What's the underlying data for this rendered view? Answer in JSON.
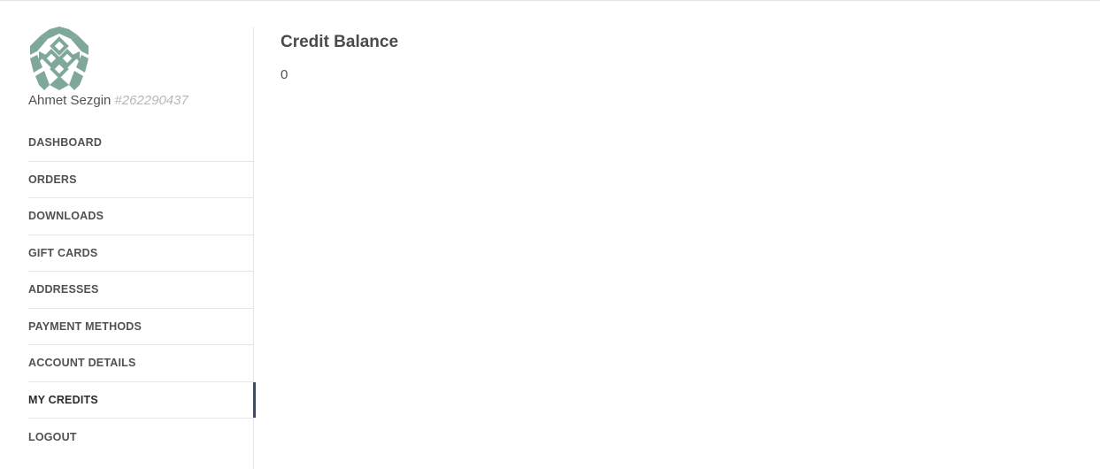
{
  "user": {
    "name": "Ahmet Sezgin",
    "id": "#262290437",
    "avatar_icon": "geometric-identicon-icon",
    "avatar_color": "#7fa89b"
  },
  "nav": {
    "items": [
      {
        "label": "DASHBOARD"
      },
      {
        "label": "ORDERS"
      },
      {
        "label": "DOWNLOADS"
      },
      {
        "label": "GIFT CARDS"
      },
      {
        "label": "ADDRESSES"
      },
      {
        "label": "PAYMENT METHODS"
      },
      {
        "label": "ACCOUNT DETAILS"
      },
      {
        "label": "MY CREDITS",
        "active": true
      },
      {
        "label": "LOGOUT"
      }
    ],
    "active_indicator_color": "#3e4a5f"
  },
  "main": {
    "title": "Credit Balance",
    "balance": "0"
  }
}
